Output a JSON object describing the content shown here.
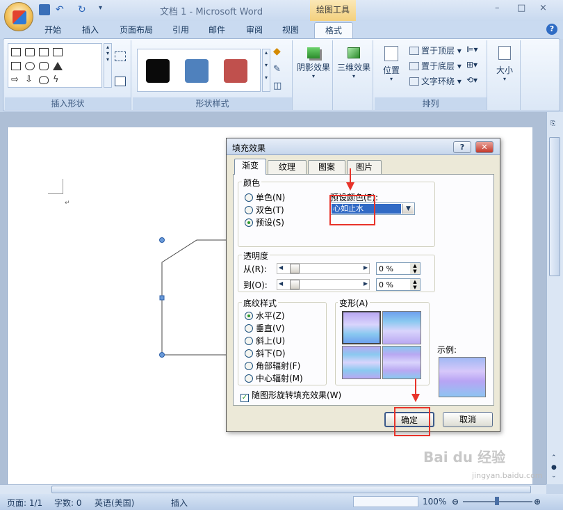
{
  "app": {
    "title": "文档 1 - Microsoft Word",
    "context_tab_title": "绘图工具",
    "window_controls": [
      "–",
      "□",
      "×"
    ]
  },
  "ribbon": {
    "tabs": [
      "开始",
      "插入",
      "页面布局",
      "引用",
      "邮件",
      "审阅",
      "视图",
      "格式"
    ],
    "active_tab": "格式",
    "groups": {
      "insert_shapes": "插入形状",
      "shape_styles": "形状样式",
      "arrange": "排列"
    },
    "buttons": {
      "shadow_effects": "阴影效果",
      "3d_effects": "三维效果",
      "position": "位置",
      "bring_to_front": "置于顶层",
      "send_to_back": "置于底层",
      "text_wrapping": "文字环绕",
      "size": "大小"
    },
    "style_swatches": [
      "#0a0a0a",
      "#4f81bd",
      "#c0504d"
    ]
  },
  "dialog": {
    "title": "填充效果",
    "help_btn": "?",
    "close_btn": "✕",
    "tabs": [
      "渐变",
      "纹理",
      "图案",
      "图片"
    ],
    "active_tab": "渐变",
    "color_group": "颜色",
    "color_options": [
      "单色(N)",
      "双色(T)",
      "预设(S)"
    ],
    "color_selected": "预设(S)",
    "preset_label": "预设颜色(E):",
    "preset_value": "心如止水",
    "transparency_group": "透明度",
    "from_label": "从(R):",
    "to_label": "到(O):",
    "from_value": "0 %",
    "to_value": "0 %",
    "shading_group": "底纹样式",
    "shading_options": [
      "水平(Z)",
      "垂直(V)",
      "斜上(U)",
      "斜下(D)",
      "角部辐射(F)",
      "中心辐射(M)"
    ],
    "shading_selected": "水平(Z)",
    "variants_label": "变形(A)",
    "sample_label": "示例:",
    "rotate_checkbox": "随图形旋转填充效果(W)",
    "ok": "确定",
    "cancel": "取消"
  },
  "status": {
    "page": "页面: 1/1",
    "words": "字数: 0",
    "language": "英语(美国)",
    "mode": "插入",
    "zoom": "100%"
  },
  "watermark": "jingyan.baidu.com"
}
